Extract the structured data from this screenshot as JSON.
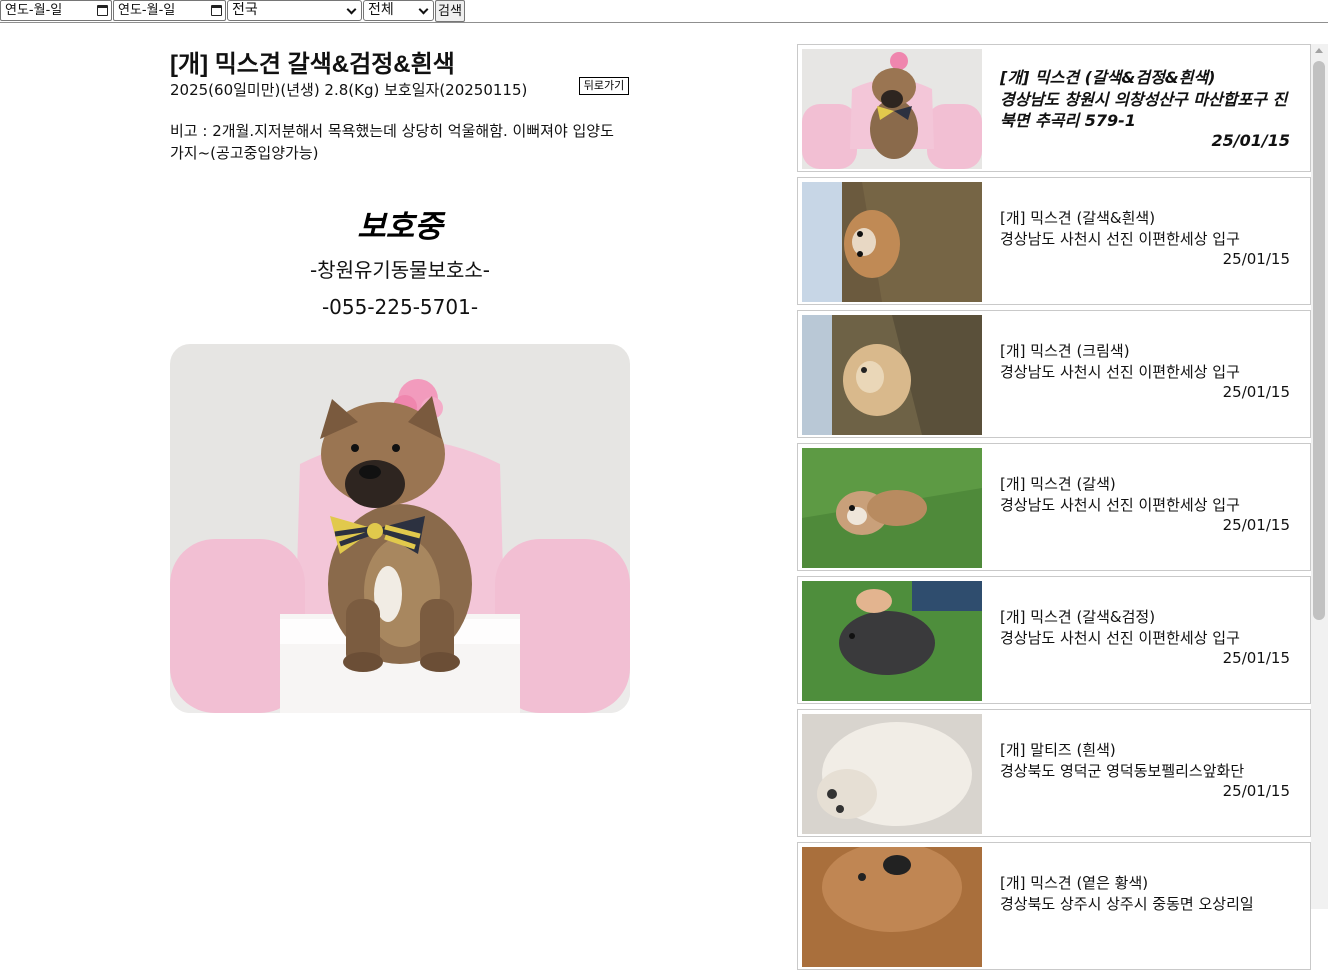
{
  "filters": {
    "start_date_placeholder": "연도-월-일",
    "end_date_placeholder": "연도-월-일",
    "region_selected": "전국",
    "type_selected": "전체",
    "search_label": "검색"
  },
  "detail": {
    "title": "[개] 믹스견 갈색&검정&흰색",
    "meta": "2025(60일미만)(년생) 2.8(Kg) 보호일자(20250115)",
    "back_label": "뒤로가기",
    "note": "비고 : 2개월.지저분해서 목욕했는데 상당히 억울해함. 이뻐져야 입양도 가지~(공고중입양가능)",
    "status": "보호중",
    "shelter": "-창원유기동물보호소-",
    "phone": "-055-225-5701-",
    "photo_icon": "puppy-photo"
  },
  "list": {
    "cards": [
      {
        "kind": "[개] 믹스견 (갈색&검정&흰색)",
        "address": "경상남도 창원시 의창성산구 마산합포구 진북면 추곡리 579-1",
        "date": "25/01/15"
      },
      {
        "kind": "[개] 믹스견 (갈색&흰색)",
        "address": "경상남도 사천시 선진 이편한세상 입구",
        "date": "25/01/15"
      },
      {
        "kind": "[개] 믹스견 (크림색)",
        "address": "경상남도 사천시 선진 이편한세상 입구",
        "date": "25/01/15"
      },
      {
        "kind": "[개] 믹스견 (갈색)",
        "address": "경상남도 사천시 선진 이편한세상 입구",
        "date": "25/01/15"
      },
      {
        "kind": "[개] 믹스견 (갈색&검정)",
        "address": "경상남도 사천시 선진 이편한세상 입구",
        "date": "25/01/15"
      },
      {
        "kind": "[개] 말티즈 (흰색)",
        "address": "경상북도 영덕군 영덕동보펠리스앞화단",
        "date": "25/01/15"
      },
      {
        "kind": "[개] 믹스견 (옅은 황색)",
        "address": "경상북도 상주시 상주시 중동면 오상리일",
        "date": ""
      }
    ]
  }
}
